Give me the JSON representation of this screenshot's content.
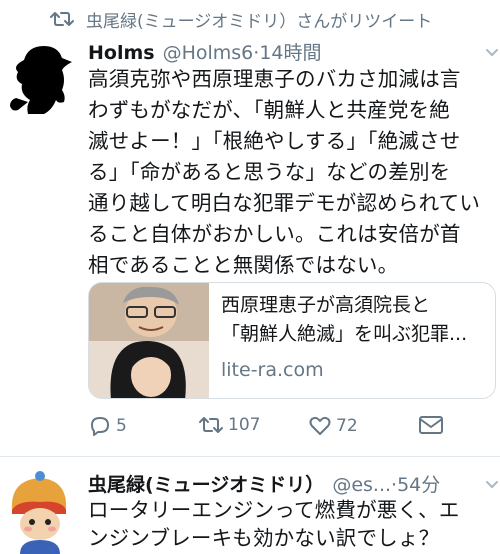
{
  "retweet": {
    "text": "虫尾緑(ミュージオミドリ）さんがリツイート",
    "icon": "retweet-icon"
  },
  "tweet1": {
    "author_name": "Holms",
    "author_handle": "@Holms6",
    "separator": "·",
    "time": "14時間",
    "body_lines": [
      "高須克弥や西原理恵子のバカさ加減は言",
      "わずもがなだが、「朝鮮人と共産党を絶",
      "滅せよー！」「根絶やしする」「絶滅させ",
      "る」「命があると思うな」などの差別を",
      "通り越して明白な犯罪デモが認められてい",
      "ること自体がおかしい。これは安倍が首",
      "相であることと無関係ではない。"
    ],
    "card": {
      "title_line1": "西原理恵子が高須院長と",
      "title_line2": "「朝鮮人絶滅」を叫ぶ犯罪...",
      "domain": "lite-ra.com"
    },
    "actions": {
      "reply_count": "5",
      "retweet_count": "107",
      "like_count": "72"
    }
  },
  "tweet2": {
    "author_name": "虫尾緑(ミュージオミドリ）",
    "author_handle": "@es...",
    "separator": "·",
    "time": "54分",
    "body_lines": [
      "ロータリーエンジンって燃費が悪く、エ",
      "ンジンブレーキも効かない訳でしょ？"
    ]
  },
  "colors": {
    "text": "#14171a",
    "secondary": "#657786",
    "border": "#e1e8ed"
  }
}
